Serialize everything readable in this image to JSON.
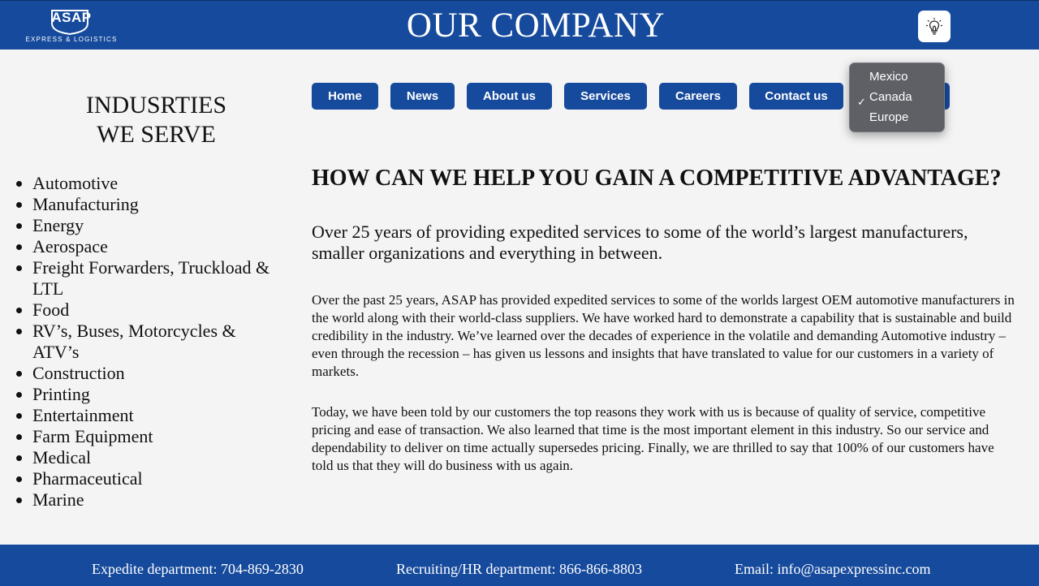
{
  "header": {
    "logo_text": "ASAP",
    "logo_subtext": "EXPRESS & LOGISTICS",
    "title": "OUR COMPANY",
    "theme_icon": "lightbulb-icon"
  },
  "sidebar": {
    "title_line1": "INDUSRTIES",
    "title_line2": "WE SERVE",
    "industries": [
      "Automotive",
      "Manufacturing",
      "Energy",
      "Aerospace",
      "Freight Forwarders, Truckload & LTL",
      "Food",
      "RV’s, Buses, Motorcycles & ATV’s",
      "Construction",
      "Printing",
      "Entertainment",
      "Farm Equipment",
      "Medical",
      "Pharmaceutical",
      "Marine"
    ]
  },
  "nav": {
    "items": [
      "Home",
      "News",
      "About us",
      "Services",
      "Careers",
      "Contact us"
    ]
  },
  "region_select": {
    "selected": "Canada",
    "options": [
      "Mexico",
      "Canada",
      "Europe"
    ]
  },
  "main": {
    "headline": "HOW CAN WE HELP YOU GAIN A COMPETITIVE ADVANTAGE?",
    "lead": "Over 25 years of providing expedited services to some of the world’s largest manufacturers, smaller organizations and everything in between.",
    "paragraph1": "Over the past 25 years, ASAP has provided expedited services to some of the worlds largest OEM automotive manufacturers in the world along with their world-class suppliers. We have worked hard to demonstrate a capability that is sustainable and build credibility in the industry. We’ve learned over the decades of experience in the volatile and demanding Automotive industry – even through the recession – has given us lessons and insights that have translated to value for our customers in a variety of markets.",
    "paragraph2": "Today, we have been told by our customers the top reasons they work with us is because of quality of service, competitive pricing and ease of transaction. We also learned that time is the most important element in this industry. So our service and dependability to deliver on time actually supersedes pricing. Finally, we are thrilled to say that 100% of our customers have told us that they will do business with us again."
  },
  "footer": {
    "expedite": "Expedite department: 704-869-2830",
    "recruiting": "Recruiting/HR department: 866-866-8803",
    "email": "Email: info@asapexpressinc.com"
  },
  "colors": {
    "brand_blue": "#164a9c",
    "page_bg": "#f4f4f4",
    "dropdown_bg": "#5e6066"
  }
}
